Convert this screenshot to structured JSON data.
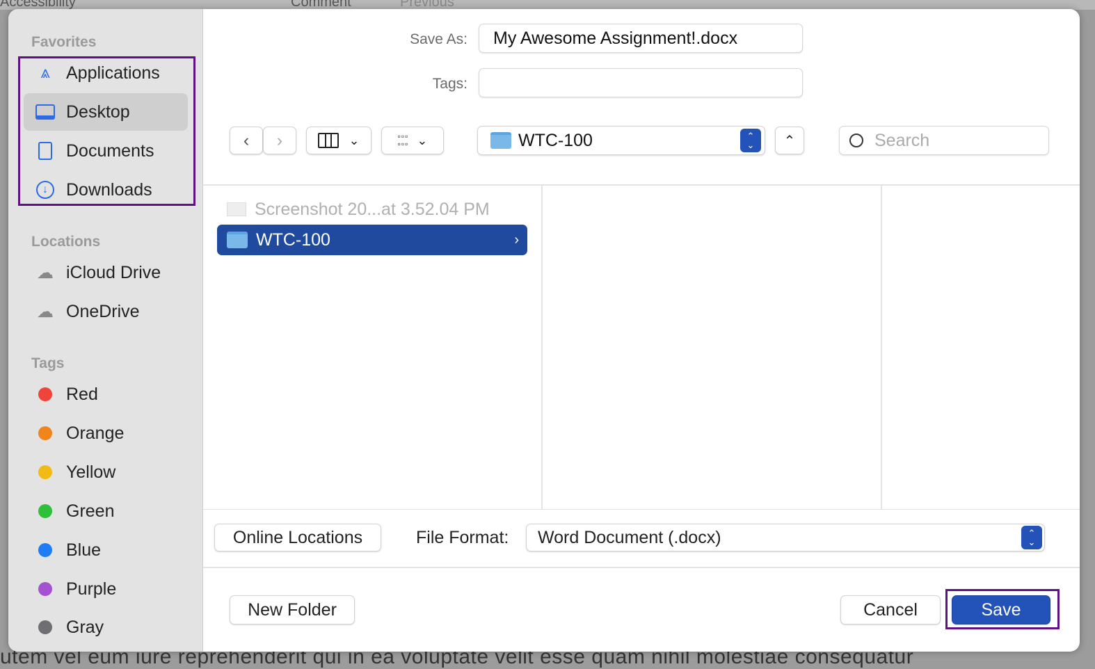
{
  "background": {
    "top_items": [
      "Accessibility",
      "Comment",
      "Previous"
    ],
    "bottom_text": "utem vel eum iure reprehenderit qui in ea voluptate velit esse quam nihil molestiae consequatur"
  },
  "sidebar": {
    "favorites_label": "Favorites",
    "favorites": [
      {
        "label": "Applications",
        "icon": "applications-icon"
      },
      {
        "label": "Desktop",
        "icon": "desktop-icon",
        "selected": true
      },
      {
        "label": "Documents",
        "icon": "document-icon"
      },
      {
        "label": "Downloads",
        "icon": "download-icon"
      }
    ],
    "locations_label": "Locations",
    "locations": [
      {
        "label": "iCloud Drive",
        "icon": "cloud-icon"
      },
      {
        "label": "OneDrive",
        "icon": "cloud-icon"
      }
    ],
    "tags_label": "Tags",
    "tags": [
      {
        "label": "Red",
        "color": "#f0443a"
      },
      {
        "label": "Orange",
        "color": "#f0851c"
      },
      {
        "label": "Yellow",
        "color": "#f0bb14"
      },
      {
        "label": "Green",
        "color": "#2ebf3b"
      },
      {
        "label": "Blue",
        "color": "#1e7cf4"
      },
      {
        "label": "Purple",
        "color": "#a452d1"
      },
      {
        "label": "Gray",
        "color": "#6e6e73"
      }
    ]
  },
  "form": {
    "save_as_label": "Save As:",
    "save_as_value": "My Awesome Assignment!.docx",
    "tags_label": "Tags:",
    "tags_value": ""
  },
  "toolbar": {
    "location": "WTC-100",
    "search_placeholder": "Search"
  },
  "browser": {
    "items": [
      {
        "name": "Screenshot 20...at 3.52.04 PM",
        "disabled": true
      },
      {
        "name": "WTC-100",
        "selected": true
      }
    ]
  },
  "format": {
    "online_locations": "Online Locations",
    "file_format_label": "File Format:",
    "file_format_value": "Word Document (.docx)"
  },
  "footer": {
    "new_folder": "New Folder",
    "cancel": "Cancel",
    "save": "Save"
  },
  "colors": {
    "accent": "#2352b8",
    "highlight_box": "#5e1283",
    "selection": "#1f4a9e"
  }
}
